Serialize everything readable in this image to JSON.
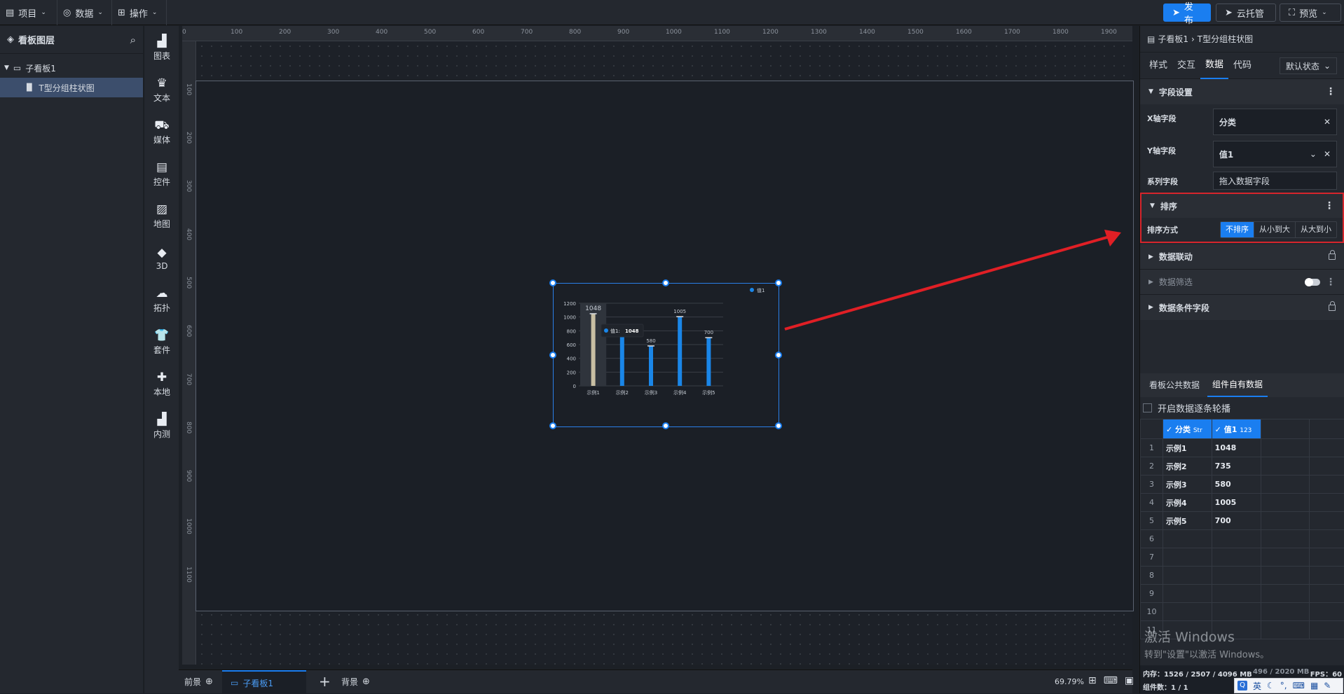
{
  "topbar": {
    "menus": [
      {
        "icon": "file-icon",
        "label": "项目"
      },
      {
        "icon": "database-icon",
        "label": "数据"
      },
      {
        "icon": "grid-icon",
        "label": "操作"
      }
    ],
    "publish_label": "发布",
    "cloud_label": "云托管",
    "preview_label": "预览"
  },
  "layers": {
    "title": "看板图层",
    "board_name": "子看板1",
    "component_name": "T型分组柱状图"
  },
  "tools": [
    {
      "icon": "bar-chart-icon",
      "label": "图表"
    },
    {
      "icon": "crown-icon",
      "label": "文本"
    },
    {
      "icon": "media-icon",
      "label": "媒体"
    },
    {
      "icon": "controls-icon",
      "label": "控件"
    },
    {
      "icon": "map-icon",
      "label": "地图"
    },
    {
      "icon": "cube-icon",
      "label": "3D"
    },
    {
      "icon": "topology-icon",
      "label": "拓扑"
    },
    {
      "icon": "shirt-icon",
      "label": "套件"
    },
    {
      "icon": "puzzle-icon",
      "label": "本地"
    },
    {
      "icon": "bar-chart-icon",
      "label": "内测"
    }
  ],
  "ruler": {
    "top": [
      "0",
      "100",
      "200",
      "300",
      "400",
      "500",
      "600",
      "700",
      "800",
      "900",
      "1000",
      "1100",
      "1200",
      "1300",
      "1400",
      "1500",
      "1600",
      "1700",
      "1800",
      "1900"
    ],
    "left": [
      "100",
      "200",
      "300",
      "400",
      "500",
      "600",
      "700",
      "800",
      "900",
      "1000",
      "1100"
    ]
  },
  "chart_data": {
    "type": "bar",
    "categories": [
      "示例1",
      "示例2",
      "示例3",
      "示例4",
      "示例5"
    ],
    "series": [
      {
        "name": "值1",
        "values": [
          1048,
          735,
          580,
          1005,
          700
        ]
      }
    ],
    "ylim": [
      0,
      1200
    ],
    "yticks": [
      "0",
      "200",
      "400",
      "600",
      "800",
      "1000",
      "1200"
    ],
    "data_labels": [
      "1048",
      "",
      "580",
      "1005",
      "700"
    ],
    "legend_position": "top-right",
    "tooltip": {
      "label": "值1:",
      "value": "1048"
    },
    "highlight_color": "#c8bfa3",
    "bar_color": "#1a86e8",
    "grid": true
  },
  "bottombar": {
    "front_label": "前景",
    "board_tab": "子看板1",
    "back_label": "背景",
    "zoom": "69.79%"
  },
  "right_panel": {
    "breadcrumb_parent": "子看板1",
    "breadcrumb_current": "T型分组柱状图",
    "tabs": [
      "样式",
      "交互",
      "数据",
      "代码"
    ],
    "state_label": "默认状态",
    "field_section": "字段设置",
    "x_label": "X轴字段",
    "x_value": "分类",
    "y_label": "Y轴字段",
    "y_value": "值1",
    "series_label": "系列字段",
    "series_placeholder": "拖入数据字段",
    "sort_section": "排序",
    "sort_label": "排序方式",
    "sort_options": [
      "不排序",
      "从小到大",
      "从大到小"
    ],
    "link_section": "数据联动",
    "filter_section": "数据筛选",
    "cond_section": "数据条件字段",
    "data_tabs": [
      "看板公共数据",
      "组件自有数据"
    ],
    "carousel_label": "开启数据逐条轮播",
    "col_headers": [
      {
        "name": "分类",
        "type": "Str"
      },
      {
        "name": "值1",
        "type": "123"
      }
    ],
    "rows": [
      [
        "示例1",
        "1048"
      ],
      [
        "示例2",
        "735"
      ],
      [
        "示例3",
        "580"
      ],
      [
        "示例4",
        "1005"
      ],
      [
        "示例5",
        "700"
      ]
    ],
    "row_numbers": [
      "1",
      "2",
      "3",
      "4",
      "5",
      "6",
      "7",
      "8",
      "9",
      "10",
      "11"
    ],
    "status_memory": "内存：1526 / 2507 / 4096 MB",
    "status_mem2": "496 / 2020 MB",
    "status_fps": "FPS：60",
    "status_components": "组件数：1 / 1"
  },
  "watermark": {
    "line1": "激活 Windows",
    "line2": "转到\"设置\"以激活 Windows。"
  },
  "ime_bar": {
    "lang": "英"
  }
}
